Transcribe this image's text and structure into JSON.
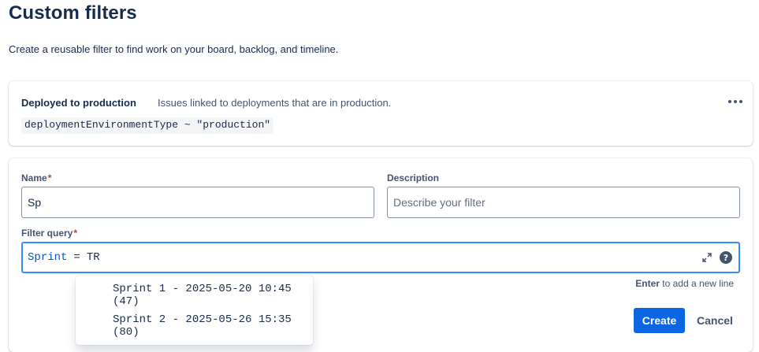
{
  "page": {
    "title": "Custom filters",
    "description": "Create a reusable filter to find work on your board, backlog, and timeline."
  },
  "existing_filter": {
    "name": "Deployed to production",
    "description": "Issues linked to deployments that are in production.",
    "query": "deploymentEnvironmentType ~ \"production\"",
    "more_icon": "more-horizontal-icon"
  },
  "form": {
    "name_label": "Name",
    "required_mark": "*",
    "name_value": "Sp",
    "description_label": "Description",
    "description_placeholder": "Describe your filter",
    "query_label": "Filter query",
    "query": {
      "keyword": "Sprint",
      "operator": "=",
      "value": "TR"
    },
    "expand_icon": "expand-icon",
    "help_icon": "question-circle-icon",
    "help_glyph": "?",
    "hint_key": "Enter",
    "hint_text": " to add a new line",
    "create_label": "Create",
    "cancel_label": "Cancel"
  },
  "suggestions": [
    "Sprint 1 - 2025-05-20 10:45 (47)",
    "Sprint 2 - 2025-05-26 15:35 (80)"
  ],
  "colors": {
    "accent": "#0c66e4",
    "focus_border": "#388bff",
    "required": "#c9372c",
    "keyword": "#0055cc"
  }
}
